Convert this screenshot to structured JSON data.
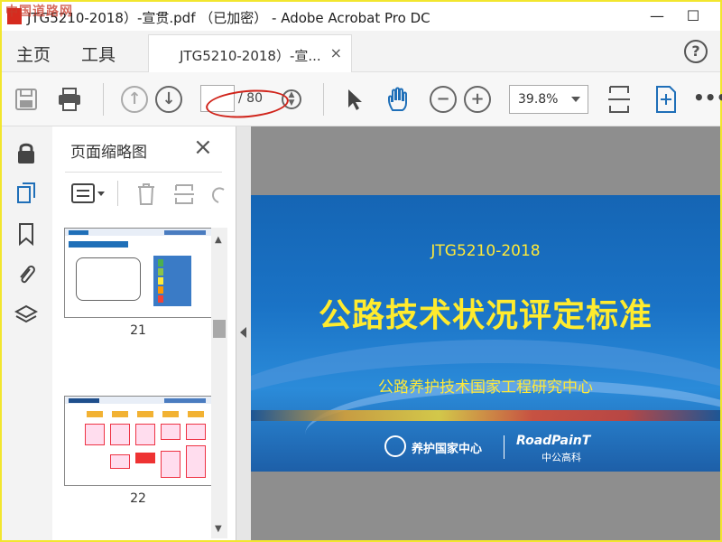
{
  "window": {
    "title": "JTG5210-2018）-宣贯.pdf （已加密） - Adobe Acrobat Pro DC",
    "watermark": "中国道路网",
    "minimize": "—",
    "maximize": "☐"
  },
  "menu": {
    "home": "主页",
    "tools": "工具",
    "tab_label": "JTG5210-2018）-宣...",
    "tab_close": "×",
    "help": "?"
  },
  "toolbar": {
    "page_current": "",
    "page_total": "/ 80",
    "zoom": "39.8%"
  },
  "panel": {
    "title": "页面缩略图",
    "close": "×",
    "thumbs": [
      {
        "num": "21"
      },
      {
        "num": "22"
      }
    ]
  },
  "slide": {
    "code": "JTG5210-2018",
    "headline": "公路技术状况评定标准",
    "org": "公路养护技术国家工程研究中心",
    "logo1": "养护国家中心",
    "logo2": "RoadPainT",
    "logo2_sub": "中公高科"
  },
  "colors": {
    "accent_red": "#d0241b",
    "slide_blue": "#1a73c6",
    "slide_yellow": "#ffeb2e"
  },
  "icons": [
    "app-icon",
    "save-icon",
    "print-icon",
    "page-up-icon",
    "page-down-icon",
    "page-nav-icon",
    "select-cursor-icon",
    "hand-tool-icon",
    "zoom-out-icon",
    "zoom-in-icon",
    "fit-page-icon",
    "fullscreen-icon",
    "more-icon",
    "lock-icon",
    "pages-icon",
    "bookmark-icon",
    "attachment-icon",
    "layers-icon",
    "thumbnail-options-icon",
    "delete-page-icon",
    "extract-icon",
    "rotate-icon"
  ]
}
